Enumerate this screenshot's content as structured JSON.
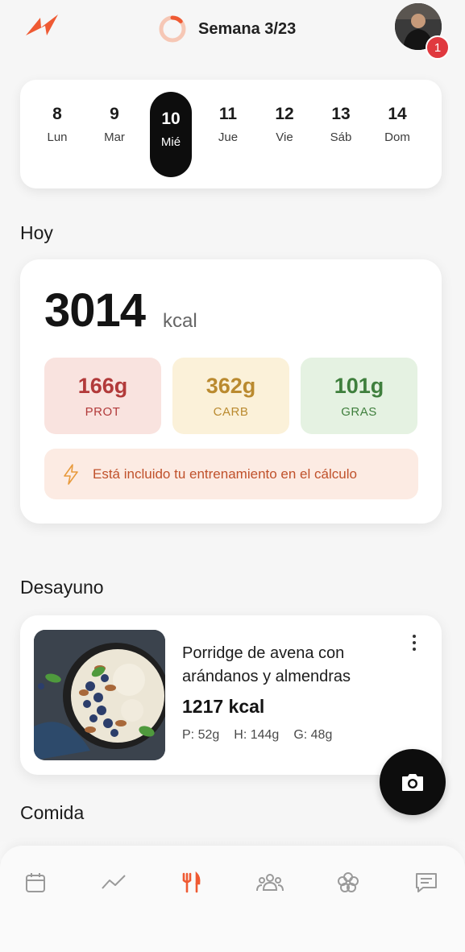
{
  "header": {
    "logo_icon": "bolt-logo-icon",
    "week_label": "Semana 3/23",
    "week_progress": 0.13,
    "notifications_count": "1",
    "accent_color": "#ef5a33"
  },
  "calendar": {
    "days": [
      {
        "num": "8",
        "wd": "Lun",
        "active": false
      },
      {
        "num": "9",
        "wd": "Mar",
        "active": false
      },
      {
        "num": "10",
        "wd": "Mié",
        "active": true
      },
      {
        "num": "11",
        "wd": "Jue",
        "active": false
      },
      {
        "num": "12",
        "wd": "Vie",
        "active": false
      },
      {
        "num": "13",
        "wd": "Sáb",
        "active": false
      },
      {
        "num": "14",
        "wd": "Dom",
        "active": false
      }
    ]
  },
  "today": {
    "title": "Hoy",
    "kcal": "3014",
    "kcal_unit": "kcal",
    "macros": {
      "prot": {
        "value": "166g",
        "label": "PROT",
        "color": "#b23a3a"
      },
      "carb": {
        "value": "362g",
        "label": "CARB",
        "color": "#ba8a2f"
      },
      "gras": {
        "value": "101g",
        "label": "GRAS",
        "color": "#3f7f3d"
      }
    },
    "training_note": "Está incluido tu entrenamiento en el cálculo"
  },
  "breakfast": {
    "title": "Desayuno",
    "meal": {
      "name": "Porridge de avena con arándanos y almendras",
      "kcal": "1217 kcal",
      "protein": "P: 52g",
      "carbs": "H: 144g",
      "fat": "G: 48g"
    }
  },
  "lunch": {
    "title": "Comida"
  },
  "nav": {
    "items": [
      {
        "icon": "calendar-icon",
        "active": false
      },
      {
        "icon": "progress-chart-icon",
        "active": false
      },
      {
        "icon": "fork-knife-icon",
        "active": true
      },
      {
        "icon": "community-icon",
        "active": false
      },
      {
        "icon": "flower-icon",
        "active": false
      },
      {
        "icon": "chat-icon",
        "active": false
      }
    ]
  }
}
